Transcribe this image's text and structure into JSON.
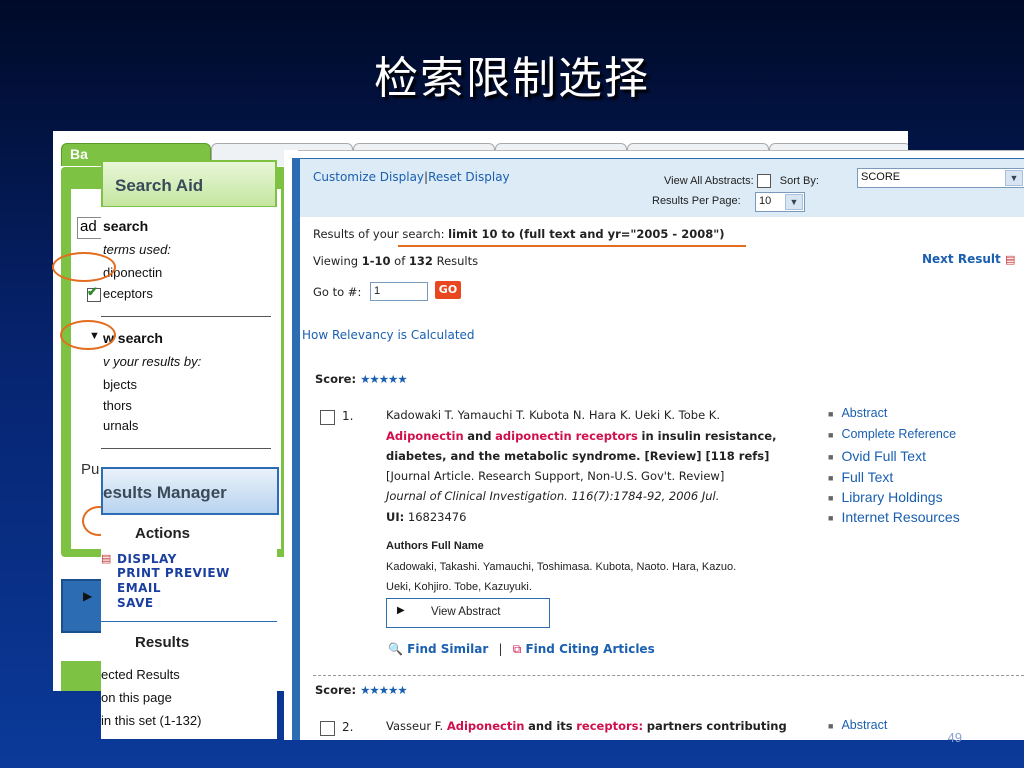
{
  "slide": {
    "title": "检索限制选择",
    "page_number": "49"
  },
  "back_window": {
    "tab_label": "Ba",
    "search_input_value": "ad",
    "side_label": "Pu"
  },
  "search_aid": {
    "title": "Search Aid",
    "section1_title": "search",
    "section1_subtitle": "terms used:",
    "term1": "diponectin",
    "term2": "eceptors",
    "section2_title": "w search",
    "section2_subtitle": "v your results by:",
    "filter1": "bjects",
    "filter2": "thors",
    "filter3": "urnals"
  },
  "results_manager": {
    "title": "esults Manager",
    "actions_title": "Actions",
    "actions": [
      "DISPLAY",
      "PRINT PREVIEW",
      "EMAIL",
      "SAVE"
    ],
    "results_title": "Results",
    "results_options": [
      "ected Results",
      "on this page",
      "in this set (1-132)"
    ]
  },
  "toolbar": {
    "customize_display": "Customize Display",
    "reset_display": "Reset Display",
    "view_all_abstracts": "View All Abstracts:",
    "sort_by_label": "Sort By:",
    "sort_by_value": "SCORE",
    "results_per_page_label": "Results Per Page:",
    "results_per_page_value": "10"
  },
  "search_summary": {
    "prefix": "Results of your search:",
    "query": "limit 10 to (full text and yr=\"2005 - 2008\")",
    "viewing_prefix": "Viewing",
    "viewing_range": "1-10",
    "viewing_of": "of",
    "viewing_total": "132",
    "viewing_suffix": "Results",
    "next_result": "Next Result",
    "goto_label": "Go to #:",
    "goto_value": "1",
    "go_button": "GO",
    "relevancy_link": "How Relevancy is Calculated"
  },
  "records": [
    {
      "score_label": "Score:",
      "stars": "★★★★★",
      "number": "1.",
      "authors": "Kadowaki T. Yamauchi T. Kubota N. Hara K. Ueki K. Tobe K.",
      "title_hl1": "Adiponectin",
      "title_and": "and",
      "title_hl2": "adiponectin receptors",
      "title_rest1": "in insulin resistance,",
      "title_rest2": "diabetes, and the metabolic syndrome. [Review] [118 refs]",
      "pub_type": "[Journal Article. Research Support, Non-U.S. Gov't. Review]",
      "citation": "Journal of Clinical Investigation. 116(7):1784-92, 2006 Jul.",
      "ui_label": "UI:",
      "ui_value": "16823476",
      "authors_full_label": "Authors Full Name",
      "authors_full_line1": "Kadowaki, Takashi. Yamauchi, Toshimasa. Kubota, Naoto. Hara, Kazuo.",
      "authors_full_line2": "Ueki, Kohjiro. Tobe, Kazuyuki.",
      "view_abstract": "View Abstract",
      "find_similar": "Find Similar",
      "find_citing": "Find Citing Articles",
      "links": [
        "Abstract",
        "Complete Reference",
        "Ovid Full Text",
        "Full Text",
        "Library Holdings",
        "Internet Resources"
      ]
    },
    {
      "score_label": "Score:",
      "stars": "★★★★★",
      "number": "2.",
      "authors": "Vasseur F.",
      "title_hl1": "Adiponectin",
      "title_and": "and its",
      "title_hl2": "receptors:",
      "title_rest1": "partners contributing",
      "links": [
        "Abstract"
      ]
    }
  ],
  "colors": {
    "accent_orange": "#e36c1e",
    "link_blue": "#1a5fb0",
    "highlight_red": "#d0104c",
    "green_panel": "#7dc242",
    "blue_panel": "#2b6cb3"
  }
}
